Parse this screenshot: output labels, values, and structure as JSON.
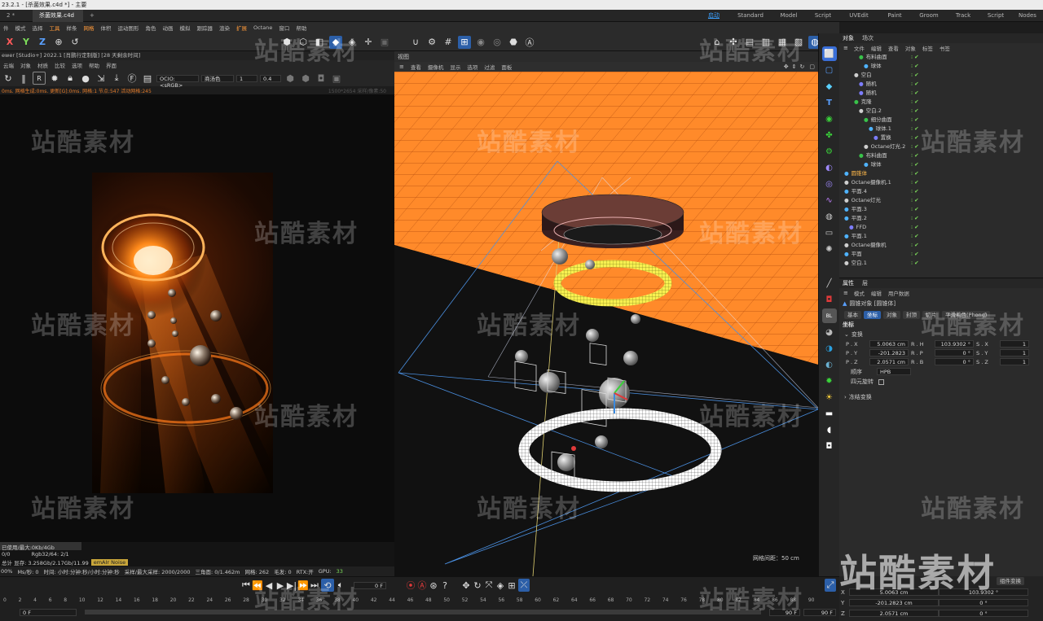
{
  "app": {
    "title": "23.2.1 - [杀菌效果.c4d *] - 主要"
  },
  "tabs": [
    {
      "label": "2 *"
    },
    {
      "label": "杀菌效果.c4d *"
    },
    {
      "label": "+"
    }
  ],
  "layouts": [
    {
      "label": "启动"
    },
    {
      "label": "Standard"
    },
    {
      "label": "Model"
    },
    {
      "label": "Script"
    },
    {
      "label": "UVEdit"
    },
    {
      "label": "Paint"
    },
    {
      "label": "Groom"
    },
    {
      "label": "Track"
    },
    {
      "label": "Script"
    },
    {
      "label": "Nodes"
    }
  ],
  "menubar": [
    {
      "label": "件"
    },
    {
      "label": "模式"
    },
    {
      "label": "选择"
    },
    {
      "label": "工具"
    },
    {
      "label": "样条"
    },
    {
      "label": "网格"
    },
    {
      "label": "体积"
    },
    {
      "label": "运动图形"
    },
    {
      "label": "角色"
    },
    {
      "label": "动画"
    },
    {
      "label": "模拟"
    },
    {
      "label": "跟踪器"
    },
    {
      "label": "渲染"
    },
    {
      "label": "扩展"
    },
    {
      "label": "Octane"
    },
    {
      "label": "窗口"
    },
    {
      "label": "帮助"
    }
  ],
  "axis_buttons": {
    "x": "X",
    "y": "Y",
    "z": "Z"
  },
  "live_viewer": {
    "title": "ewer [Studio+] 2022.1 [肖鹏行定制版] [28 天剩余时间]",
    "menu": [
      {
        "label": "云端"
      },
      {
        "label": "对象"
      },
      {
        "label": "材质"
      },
      {
        "label": "比较"
      },
      {
        "label": "选项"
      },
      {
        "label": "帮助"
      },
      {
        "label": "界面"
      }
    ],
    "ocio": "OCIO:<sRGB>",
    "mode": "商汤色",
    "value1": "1",
    "value2": "0.4",
    "status": "0ms. 网格生成:0ms. 更新[G]:0ms. 网格:1 节点:547 活动网格:245",
    "status_right": "1500*2654 采样/像素:50",
    "info_line1": "已使用/最大:0Kb/4Gb",
    "info_line2_left": "0/0",
    "info_line2_mid": "Rgb32/64: 2/1",
    "info_line3": "总计 显存: 3.258Gb/2.17Gb/11.99",
    "info_badge": "emAIr Noise",
    "bottom": {
      "pct": "00%",
      "ms": "Ms/秒: 0",
      "time": "时间: 小时:分钟:秒/小时:分钟:秒",
      "samples": "采样/最大采样: 2000/2000",
      "tri": "三角面: 0/1.462m",
      "mesh": "网格: 262",
      "hair": "毛发: 0",
      "rtx": "RTX:开",
      "gpu": "GPU:",
      "gpu_val": "33"
    }
  },
  "viewport": {
    "title": "视图",
    "menu": [
      {
        "label": "查看"
      },
      {
        "label": "摄像机"
      },
      {
        "label": "显示"
      },
      {
        "label": "选项"
      },
      {
        "label": "过滤"
      },
      {
        "label": "面板"
      }
    ],
    "camera_label": "透视视图",
    "grid_info": "网格间距：50 cm"
  },
  "objects_panel": {
    "tabs": [
      {
        "label": "对象"
      },
      {
        "label": "场次"
      }
    ],
    "menu": [
      {
        "label": "文件"
      },
      {
        "label": "编辑"
      },
      {
        "label": "查看"
      },
      {
        "label": "对象"
      },
      {
        "label": "标签"
      },
      {
        "label": "书签"
      }
    ],
    "items": [
      {
        "label": "布料曲面",
        "icon_color": "#39c24a"
      },
      {
        "label": "球体",
        "icon_color": "#4fb3ff"
      },
      {
        "label": "空白",
        "icon_color": "#cfcfcf"
      },
      {
        "label": "随机",
        "icon_color": "#7d7dff"
      },
      {
        "label": "随机",
        "icon_color": "#7d7dff"
      },
      {
        "label": "克隆",
        "icon_color": "#39c24a"
      },
      {
        "label": "空白.2",
        "icon_color": "#cfcfcf"
      },
      {
        "label": "细分曲面",
        "icon_color": "#39c24a"
      },
      {
        "label": "球体.1",
        "icon_color": "#4fb3ff"
      },
      {
        "label": "置换",
        "icon_color": "#7d7dff"
      },
      {
        "label": "Octane灯光.2",
        "icon_color": "#cfcfcf"
      },
      {
        "label": "布料曲面",
        "icon_color": "#39c24a"
      },
      {
        "label": "球体",
        "icon_color": "#4fb3ff"
      },
      {
        "label": "圆锥体",
        "icon_color": "#4fb3ff",
        "highlight": true
      },
      {
        "label": "Octane摄像机.1",
        "icon_color": "#cfcfcf"
      },
      {
        "label": "平面.4",
        "icon_color": "#4fb3ff"
      },
      {
        "label": "Octane灯光",
        "icon_color": "#cfcfcf"
      },
      {
        "label": "平面.3",
        "icon_color": "#4fb3ff"
      },
      {
        "label": "平面.2",
        "icon_color": "#4fb3ff"
      },
      {
        "label": "FFD",
        "icon_color": "#7d7dff"
      },
      {
        "label": "平面.1",
        "icon_color": "#4fb3ff"
      },
      {
        "label": "Octane摄像机",
        "icon_color": "#cfcfcf"
      },
      {
        "label": "平面",
        "icon_color": "#4fb3ff"
      },
      {
        "label": "空白.1",
        "icon_color": "#cfcfcf"
      }
    ]
  },
  "attributes": {
    "tabs": [
      {
        "label": "属性"
      },
      {
        "label": "层"
      }
    ],
    "menu": [
      {
        "label": "模式"
      },
      {
        "label": "编辑"
      },
      {
        "label": "用户数据"
      }
    ],
    "object_title": "圆锥对象 [圆锥体]",
    "subtabs": [
      {
        "label": "基本"
      },
      {
        "label": "坐标"
      },
      {
        "label": "对象"
      },
      {
        "label": "封顶"
      },
      {
        "label": "切片"
      },
      {
        "label": "平滑着色(Phong)"
      }
    ],
    "section": "坐标",
    "group": "变换",
    "rows": [
      {
        "l1": "P . X",
        "v1": "5.0063 cm",
        "l2": "R . H",
        "v2": "103.9302 °",
        "l3": "S . X",
        "v3": "1"
      },
      {
        "l1": "P . Y",
        "v1": "-201.2823",
        "l2": "R . P",
        "v2": "0 °",
        "l3": "S . Y",
        "v3": "1"
      },
      {
        "l1": "P . Z",
        "v1": "2.0571 cm",
        "l2": "R . B",
        "v2": "0 °",
        "l3": "S . Z",
        "v3": "1"
      }
    ],
    "order_label": "顺序",
    "order_value": "HPB",
    "quat_label": "四元旋转",
    "freeze_label": "冻结变换"
  },
  "timeline": {
    "frame": "0 F",
    "start": "0 F",
    "end": "90 F",
    "end2": "90 F",
    "ticks": [
      "0",
      "2",
      "4",
      "6",
      "8",
      "10",
      "12",
      "14",
      "16",
      "18",
      "20",
      "22",
      "24",
      "26",
      "28",
      "30",
      "32",
      "34",
      "36",
      "38",
      "40",
      "42",
      "44",
      "46",
      "48",
      "50",
      "52",
      "54",
      "56",
      "58",
      "60",
      "62",
      "64",
      "66",
      "68",
      "70",
      "72",
      "74",
      "76",
      "78",
      "80",
      "82",
      "84",
      "86",
      "88",
      "90"
    ]
  },
  "coords": {
    "x_label": "X",
    "y_label": "Y",
    "z_label": "Z",
    "x_pos": "5.0063 cm",
    "y_pos": "-201.2823 cm",
    "z_pos": "2.0571 cm",
    "x_rot": "103.9302 °",
    "y_rot": "0 °",
    "z_rot": "0 °",
    "apply": "组件变换"
  },
  "watermark": "站酷素材"
}
